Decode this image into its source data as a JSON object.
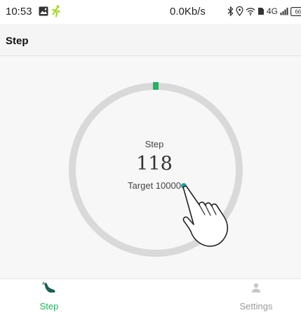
{
  "status_bar": {
    "time": "10:53",
    "speed": "0.0Kb/s",
    "network": "4G",
    "battery": "66",
    "icons": [
      "gallery-icon",
      "running-person-icon",
      "bluetooth-icon",
      "location-icon",
      "wifi-icon",
      "signal-icon",
      "battery-icon"
    ],
    "colors": {
      "run_icon": "#a5d626"
    }
  },
  "app_bar": {
    "title": "Step"
  },
  "main": {
    "label": "Step",
    "step_count": "118",
    "target_label": "Target 10000",
    "progress": {
      "steps": 118,
      "target": 10000
    },
    "colors": {
      "ring_track": "#d9d9d9",
      "progress_marker": "#21b45e",
      "knob": "#1aa5a0"
    }
  },
  "bottom_nav": {
    "items": [
      {
        "label": "Step",
        "icon": "shoe-icon",
        "active": true
      },
      {
        "label": "Settings",
        "icon": "person-icon",
        "active": false
      }
    ],
    "colors": {
      "active": "#21b45e",
      "inactive": "#9a9a9a"
    }
  }
}
